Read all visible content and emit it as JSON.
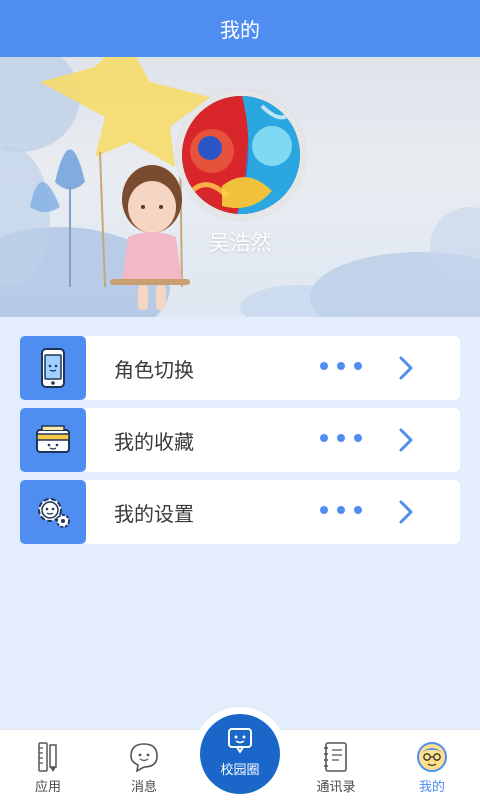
{
  "header": {
    "title": "我的"
  },
  "profile": {
    "name": "吴浩然"
  },
  "menu": {
    "items": [
      {
        "label": "角色切换",
        "icon": "phone-icon"
      },
      {
        "label": "我的收藏",
        "icon": "wallet-icon"
      },
      {
        "label": "我的设置",
        "icon": "gear-icon"
      }
    ]
  },
  "tabbar": {
    "items": [
      {
        "label": "应用",
        "icon": "ruler-pencil-icon"
      },
      {
        "label": "消息",
        "icon": "chat-bubble-icon"
      },
      {
        "label": "校园圈",
        "icon": "campus-chat-icon"
      },
      {
        "label": "通讯录",
        "icon": "address-book-icon"
      },
      {
        "label": "我的",
        "icon": "user-face-icon"
      }
    ],
    "active": "我的"
  },
  "colors": {
    "primary": "#4f8ef0",
    "center_button": "#1a66c9",
    "background": "#e3edfb"
  }
}
